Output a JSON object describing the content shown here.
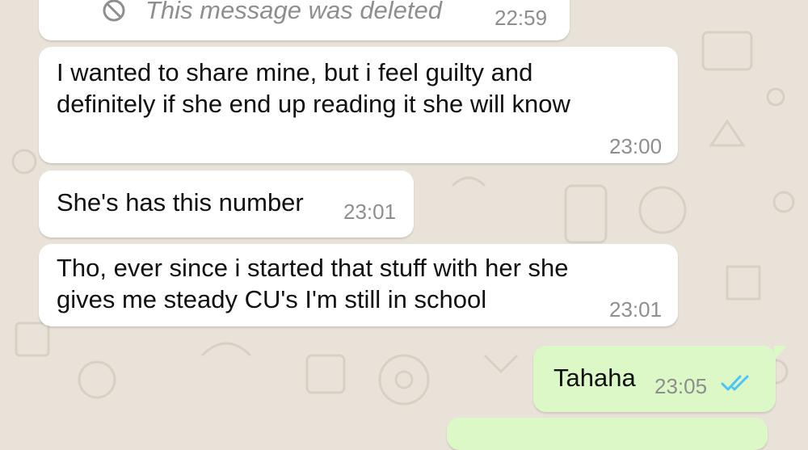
{
  "chat": {
    "messages": [
      {
        "direction": "in",
        "deleted": true,
        "text": "This message was deleted",
        "time": "22:59"
      },
      {
        "direction": "in",
        "text_lines": [
          "I wanted to share mine, but i feel guilty and",
          "definitely if she end up reading it she will know"
        ],
        "time": "23:00"
      },
      {
        "direction": "in",
        "text": "She's has this number",
        "time": "23:01"
      },
      {
        "direction": "in",
        "text_lines": [
          "Tho, ever since i started that stuff with her she",
          "gives me steady CU's I'm still in school"
        ],
        "time": "23:01"
      },
      {
        "direction": "out",
        "text": "Tahaha",
        "time": "23:05",
        "status": "read"
      }
    ]
  },
  "icons": {
    "deleted": "block-icon",
    "read_receipt": "double-check-icon"
  },
  "colors": {
    "background": "#e9e2d8",
    "incoming_bubble": "#ffffff",
    "outgoing_bubble": "#dcf8c6",
    "read_ticks": "#4fc3f7",
    "timestamp": "#8e8e8e"
  }
}
